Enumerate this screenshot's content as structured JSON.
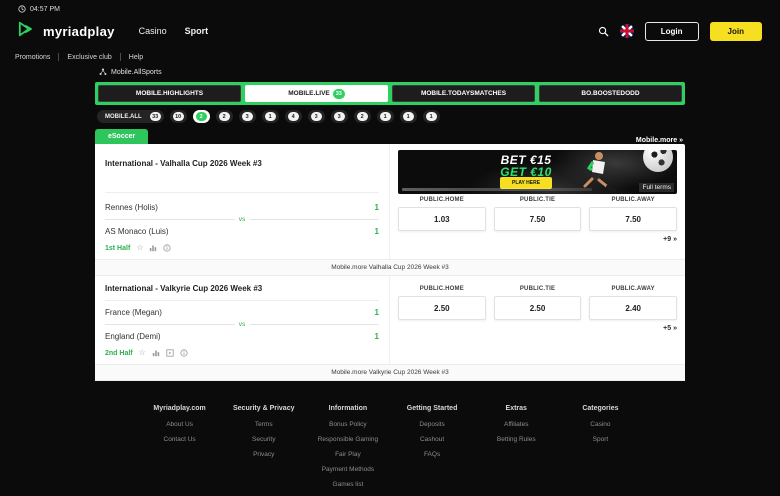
{
  "statusbar": {
    "time": "04:57 PM"
  },
  "header": {
    "logo_text": "myriadplay",
    "nav": [
      {
        "label": "Casino"
      },
      {
        "label": "Sport"
      }
    ],
    "login_label": "Login",
    "join_label": "Join"
  },
  "subnav": {
    "items": [
      "Promotions",
      "Exclusive club",
      "Help"
    ]
  },
  "breadcrumb": {
    "label": "Mobile.AllSports"
  },
  "tabs": [
    {
      "label": "MOBILE.HIGHLIGHTS"
    },
    {
      "label": "MOBILE.LIVE",
      "badge": "33"
    },
    {
      "label": "MOBILE.TODAYSMATCHES"
    },
    {
      "label": "BO.BOOSTEDODD"
    }
  ],
  "filters": {
    "all_label": "MOBILE.ALL",
    "all_badge": "33",
    "counts": [
      "10",
      "2",
      "2",
      "3",
      "1",
      "4",
      "3",
      "3",
      "2",
      "1",
      "1",
      "1"
    ]
  },
  "sport_tab": "eSoccer",
  "more_link": "Mobile.more »",
  "banner": {
    "line1": "BET €15",
    "line2": "GET €10",
    "cta": "PLAY HERE",
    "full_terms": "Full terms"
  },
  "odds_headers": [
    "PUBLIC.HOME",
    "PUBLIC.TIE",
    "PUBLIC.AWAY"
  ],
  "matches": [
    {
      "league": "International - Valhalla Cup 2026 Week #3",
      "home": "Rennes (Holis)",
      "away": "AS Monaco (Luis)",
      "home_score": "1",
      "away_score": "1",
      "vs": "vs",
      "period": "1st Half",
      "odds": [
        "1.03",
        "7.50",
        "7.50"
      ],
      "more_count": "+9 »",
      "footer": "Mobile.more Valhalla Cup 2026 Week #3"
    },
    {
      "league": "International - Valkyrie Cup 2026 Week #3",
      "home": "France (Megan)",
      "away": "England (Demi)",
      "home_score": "1",
      "away_score": "1",
      "vs": "vs",
      "period": "2nd Half",
      "odds": [
        "2.50",
        "2.50",
        "2.40"
      ],
      "more_count": "+5 »",
      "footer": "Mobile.more Valkyrie Cup 2026 Week #3"
    }
  ],
  "footer": {
    "columns": [
      {
        "title": "Myriadplay.com",
        "links": [
          "About Us",
          "Contact Us"
        ]
      },
      {
        "title": "Security & Privacy",
        "links": [
          "Terms",
          "Security",
          "Privacy"
        ]
      },
      {
        "title": "Information",
        "links": [
          "Bonus Policy",
          "Responsible Gaming",
          "Fair Play",
          "Payment Methods",
          "Games list"
        ]
      },
      {
        "title": "Getting Started",
        "links": [
          "Deposits",
          "Cashout",
          "FAQs"
        ]
      },
      {
        "title": "Extras",
        "links": [
          "Affiliates",
          "Betting Rules"
        ]
      },
      {
        "title": "Categories",
        "links": [
          "Casino",
          "Sport"
        ]
      }
    ]
  },
  "colors": {
    "accent_green": "#2ed160",
    "join_yellow": "#f6df20"
  }
}
